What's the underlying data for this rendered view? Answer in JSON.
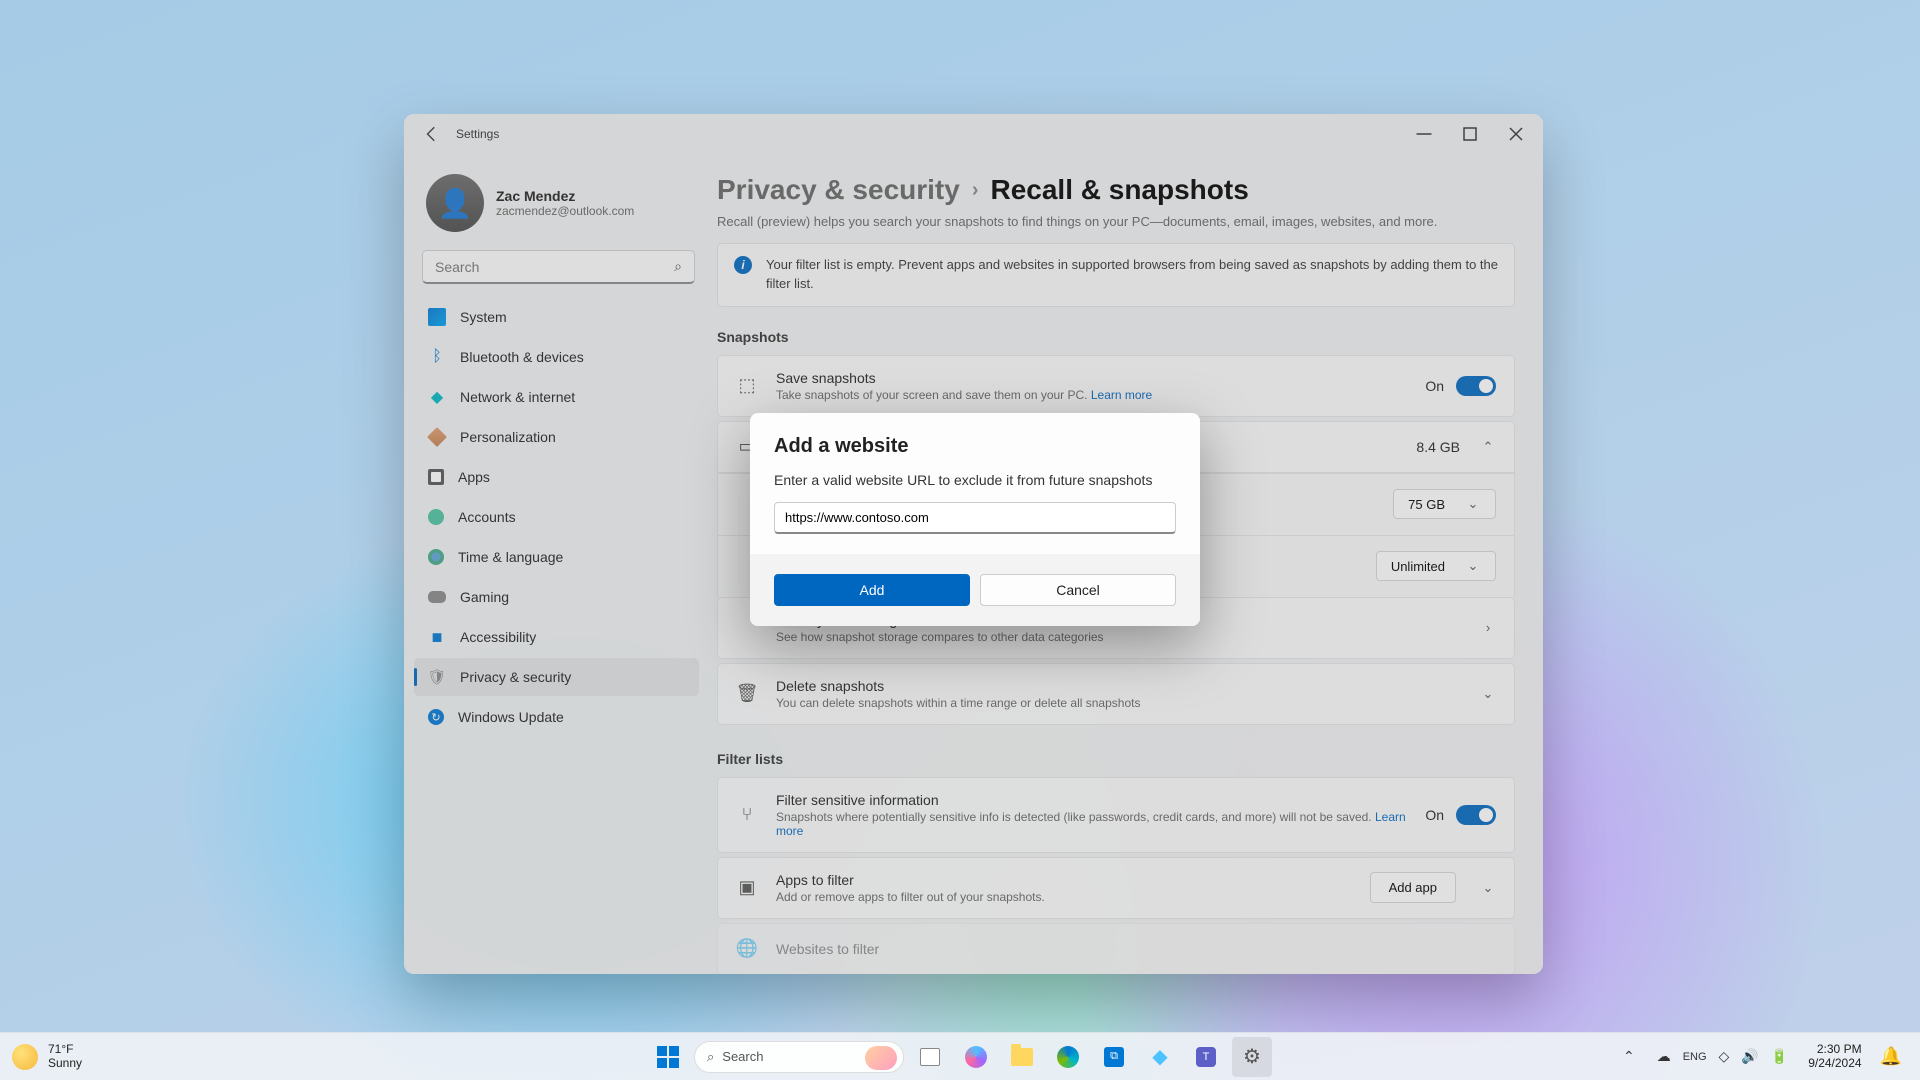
{
  "window": {
    "title": "Settings"
  },
  "user": {
    "name": "Zac Mendez",
    "email": "zacmendez@outlook.com"
  },
  "search": {
    "placeholder": "Search"
  },
  "nav": [
    {
      "label": "System"
    },
    {
      "label": "Bluetooth & devices"
    },
    {
      "label": "Network & internet"
    },
    {
      "label": "Personalization"
    },
    {
      "label": "Apps"
    },
    {
      "label": "Accounts"
    },
    {
      "label": "Time & language"
    },
    {
      "label": "Gaming"
    },
    {
      "label": "Accessibility"
    },
    {
      "label": "Privacy & security"
    },
    {
      "label": "Windows Update"
    }
  ],
  "breadcrumb": {
    "parent": "Privacy & security",
    "current": "Recall & snapshots"
  },
  "page_desc": "Recall (preview) helps you search your snapshots to find things on your PC—documents, email, images, websites, and more.",
  "info_banner": "Your filter list is empty. Prevent apps and websites in supported browsers from being saved as snapshots by adding them to the filter list.",
  "sections": {
    "snapshots": {
      "title": "Snapshots",
      "save": {
        "title": "Save snapshots",
        "sub": "Take snapshots of your screen and save them on your PC. ",
        "learn": "Learn more",
        "state": "On"
      },
      "storage_value": "8.4 GB",
      "max_storage": {
        "label": "",
        "value": "75 GB"
      },
      "duration": {
        "label": "",
        "value": "Unlimited"
      },
      "view": {
        "title": "View system storage",
        "sub": "See how snapshot storage compares to other data categories"
      },
      "delete": {
        "title": "Delete snapshots",
        "sub": "You can delete snapshots within a time range or delete all snapshots"
      }
    },
    "filter": {
      "title": "Filter lists",
      "sensitive": {
        "title": "Filter sensitive information",
        "sub": "Snapshots where potentially sensitive info is detected (like passwords, credit cards, and more) will not be saved. ",
        "learn": "Learn more",
        "state": "On"
      },
      "apps": {
        "title": "Apps to filter",
        "sub": "Add or remove apps to filter out of your snapshots.",
        "btn": "Add app"
      },
      "websites": {
        "title": "Websites to filter"
      }
    }
  },
  "dialog": {
    "title": "Add a website",
    "desc": "Enter a valid website URL to exclude it from future snapshots",
    "value": "https://www.contoso.com",
    "add": "Add",
    "cancel": "Cancel"
  },
  "taskbar": {
    "weather": {
      "temp": "71°F",
      "cond": "Sunny"
    },
    "search": "Search",
    "clock": {
      "time": "2:30 PM",
      "date": "9/24/2024"
    }
  }
}
